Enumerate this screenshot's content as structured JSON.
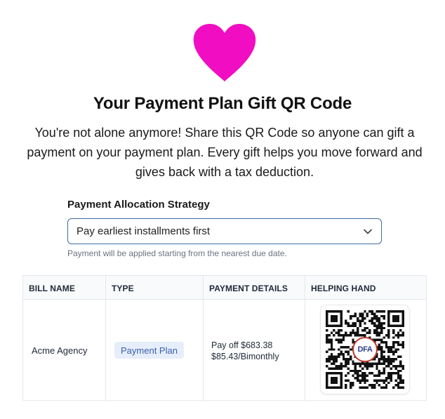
{
  "page": {
    "title": "Your Payment Plan Gift QR Code",
    "intro": "You're not alone anymore! Share this QR Code so anyone can gift a payment on your payment plan. Every gift helps you move forward and gives back with a tax deduction."
  },
  "allocation": {
    "label": "Payment Allocation Strategy",
    "selected": "Pay earliest installments first",
    "hint": "Payment will be applied starting from the nearest due date."
  },
  "table": {
    "headers": [
      "BILL NAME",
      "TYPE",
      "PAYMENT DETAILS",
      "HELPING HAND"
    ],
    "rows": [
      {
        "bill_name": "Acme Agency",
        "type": "Payment Plan",
        "payoff": "Pay off $683.38",
        "installment": "$85.43/Bimonthly",
        "qr_logo": "DFA"
      }
    ]
  },
  "colors": {
    "heart": "#f00dc2",
    "accent_border": "#3b6ea5",
    "badge_bg": "#e6eefb",
    "badge_text": "#3b5fa8"
  },
  "icons": {
    "heart": "heart-icon",
    "chevron": "chevron-down-icon",
    "qr": "qr-code-icon"
  }
}
